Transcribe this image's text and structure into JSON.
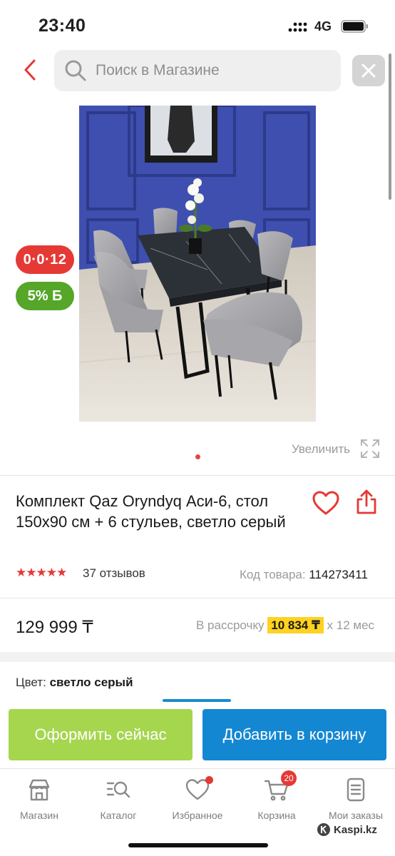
{
  "status_bar": {
    "time": "23:40",
    "network": "4G",
    "icons": [
      "signal-icon",
      "battery-icon"
    ]
  },
  "header": {
    "back_icon": "chevron-left-icon",
    "search_placeholder": "Поиск в Магазине",
    "close_icon": "close-icon"
  },
  "gallery": {
    "badges": {
      "installment": "0·0·12",
      "bonus": "5% Б"
    },
    "zoom_label": "Увеличить",
    "current_page": 1,
    "total_pages": 1
  },
  "product": {
    "title": "Комплект Qaz Oryndyq Аси-6, стол 150x90 см + 6 стульев, светло серый",
    "rating": 5,
    "rating_stars": "★★★★★",
    "reviews": "37 отзывов",
    "sku_label": "Код товара:",
    "sku_value": "114273411",
    "price": "129 999 ₸",
    "installment_prefix": "В рассрочку",
    "installment_amount": "10 834 ₸",
    "installment_suffix": "x 12 мес",
    "color_label": "Цвет:",
    "color_value": "светло серый"
  },
  "actions": {
    "buy_now": "Оформить сейчас",
    "add_to_cart": "Добавить в корзину"
  },
  "bottom_nav": {
    "items": [
      {
        "label": "Магазин",
        "icon": "shop-icon"
      },
      {
        "label": "Каталог",
        "icon": "catalog-search-icon"
      },
      {
        "label": "Избранное",
        "icon": "heart-icon"
      },
      {
        "label": "Корзина",
        "icon": "cart-icon",
        "badge": "20"
      },
      {
        "label": "Мои заказы",
        "icon": "orders-icon"
      }
    ]
  },
  "watermark": "Kaspi.kz",
  "colors": {
    "accent_red": "#e53935",
    "green": "#a5d64e",
    "blue": "#1487d2",
    "installment_highlight": "#ffd21f"
  }
}
